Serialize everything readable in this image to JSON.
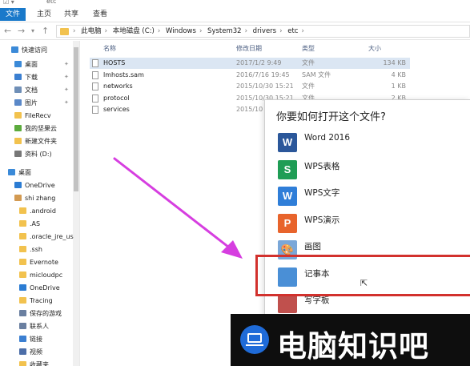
{
  "window": {
    "title": "etc",
    "quick_access_glyphs": "☑ ▾"
  },
  "ribbon": {
    "tabs": [
      "文件",
      "主页",
      "共享",
      "查看"
    ]
  },
  "address": {
    "crumbs": [
      "此电脑",
      "本地磁盘 (C:)",
      "Windows",
      "System32",
      "drivers",
      "etc"
    ]
  },
  "sidebar": {
    "items": [
      {
        "label": "快速访问",
        "icon": "star-icon",
        "color": "#3b8ad8",
        "pinned": false
      },
      {
        "label": "桌面",
        "icon": "desktop-icon",
        "color": "#3b8ad8",
        "pinned": true
      },
      {
        "label": "下载",
        "icon": "download-icon",
        "color": "#3b7fd1",
        "pinned": true
      },
      {
        "label": "文档",
        "icon": "document-icon",
        "color": "#6f8fb7",
        "pinned": true
      },
      {
        "label": "图片",
        "icon": "picture-icon",
        "color": "#5a88c8",
        "pinned": true
      },
      {
        "label": "FileRecv",
        "icon": "folder-icon",
        "color": "#f2c24e",
        "pinned": false
      },
      {
        "label": "我的坚果云",
        "icon": "cloud-folder-icon",
        "color": "#5cab3d",
        "pinned": false
      },
      {
        "label": "新建文件夹",
        "icon": "folder-icon",
        "color": "#f2c24e",
        "pinned": false
      },
      {
        "label": "资料 (D:)",
        "icon": "drive-icon",
        "color": "#777777",
        "pinned": false
      },
      {
        "label": "桌面",
        "icon": "desktop-icon",
        "color": "#3b8ad8",
        "pinned": false
      },
      {
        "label": "OneDrive",
        "icon": "onedrive-icon",
        "color": "#2b7cd3",
        "pinned": false
      },
      {
        "label": "shi zhang",
        "icon": "user-icon",
        "color": "#d39a52",
        "pinned": false
      },
      {
        "label": ".android",
        "icon": "folder-icon",
        "color": "#f2c24e",
        "pinned": false
      },
      {
        "label": ".AS",
        "icon": "folder-icon",
        "color": "#f2c24e",
        "pinned": false
      },
      {
        "label": ".oracle_jre_us",
        "icon": "folder-icon",
        "color": "#f2c24e",
        "pinned": false
      },
      {
        "label": ".ssh",
        "icon": "folder-icon",
        "color": "#f2c24e",
        "pinned": false
      },
      {
        "label": "Evernote",
        "icon": "folder-icon",
        "color": "#f2c24e",
        "pinned": false
      },
      {
        "label": "micloudpc",
        "icon": "folder-icon",
        "color": "#f2c24e",
        "pinned": false
      },
      {
        "label": "OneDrive",
        "icon": "onedrive-icon",
        "color": "#2b7cd3",
        "pinned": false
      },
      {
        "label": "Tracing",
        "icon": "folder-icon",
        "color": "#f2c24e",
        "pinned": false
      },
      {
        "label": "保存的游戏",
        "icon": "games-icon",
        "color": "#6a7fa0",
        "pinned": false
      },
      {
        "label": "联系人",
        "icon": "contacts-icon",
        "color": "#6a7fa0",
        "pinned": false
      },
      {
        "label": "链接",
        "icon": "link-icon",
        "color": "#3b7fd1",
        "pinned": false
      },
      {
        "label": "视频",
        "icon": "video-icon",
        "color": "#4c6ea8",
        "pinned": false
      },
      {
        "label": "收藏夹",
        "icon": "star-icon",
        "color": "#f2c24e",
        "pinned": false
      }
    ]
  },
  "filelist": {
    "columns": [
      "名称",
      "修改日期",
      "类型",
      "大小"
    ],
    "rows": [
      {
        "name": "HOSTS",
        "date": "2017/1/2 9:49",
        "type": "文件",
        "size": "134 KB",
        "selected": true
      },
      {
        "name": "lmhosts.sam",
        "date": "2016/7/16 19:45",
        "type": "SAM 文件",
        "size": "4 KB",
        "selected": false
      },
      {
        "name": "networks",
        "date": "2015/10/30 15:21",
        "type": "文件",
        "size": "1 KB",
        "selected": false
      },
      {
        "name": "protocol",
        "date": "2015/10/30 15:21",
        "type": "文件",
        "size": "2 KB",
        "selected": false
      },
      {
        "name": "services",
        "date": "2015/10",
        "type": "",
        "size": "",
        "selected": false
      }
    ]
  },
  "dialog": {
    "title": "你要如何打开这个文件?",
    "apps": [
      {
        "label": "Word 2016",
        "icon": "word-icon",
        "glyph": "W",
        "color": "#2b579a"
      },
      {
        "label": "WPS表格",
        "icon": "wps-spreadsheet-icon",
        "glyph": "S",
        "color": "#1f9d55"
      },
      {
        "label": "WPS文字",
        "icon": "wps-writer-icon",
        "glyph": "W",
        "color": "#2f7ed8"
      },
      {
        "label": "WPS演示",
        "icon": "wps-presentation-icon",
        "glyph": "P",
        "color": "#e8642c"
      },
      {
        "label": "画图",
        "icon": "paint-icon",
        "glyph": "🎨",
        "color": "#7aa7d8"
      },
      {
        "label": "记事本",
        "icon": "notepad-icon",
        "glyph": "",
        "color": "#4a8fd6"
      },
      {
        "label": "写字板",
        "icon": "wordpad-icon",
        "glyph": "",
        "color": "#c0504d"
      }
    ]
  },
  "watermark": {
    "text": "电脑知识吧",
    "icon": "computer-icon"
  },
  "colors": {
    "highlight": "#d2312d",
    "arrow": "#d63ee0",
    "accent": "#1979ca"
  }
}
